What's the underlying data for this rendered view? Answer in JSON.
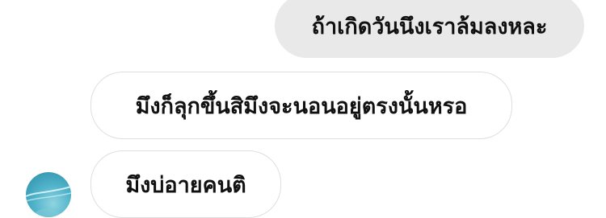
{
  "conversation": {
    "messages": [
      {
        "direction": "outgoing",
        "text": "ถ้าเกิดวันนึงเราล้มลงหละ"
      },
      {
        "direction": "incoming",
        "text": "มึงก็ลุกขึ้นสิมึงจะนอนอยู่ตรงนั้นหรอ"
      },
      {
        "direction": "incoming",
        "text": "มึงบ่อายคนติ"
      }
    ],
    "sender_avatar_icon": "profile-avatar"
  }
}
